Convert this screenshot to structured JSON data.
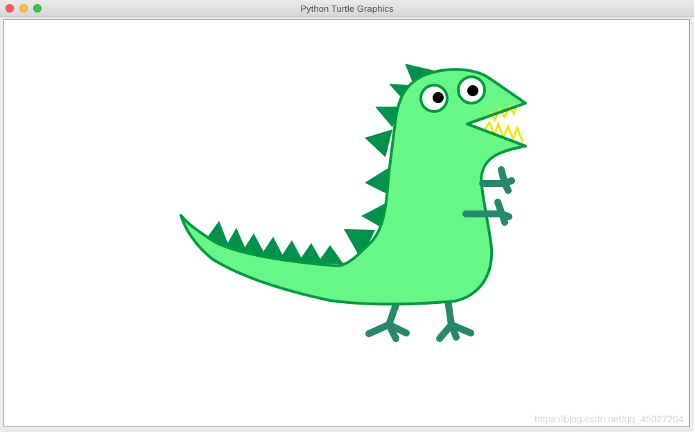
{
  "window": {
    "title": "Python Turtle Graphics",
    "controls": [
      "close-button",
      "minimize-button",
      "zoom-button"
    ]
  },
  "canvas": {
    "background": "#ffffff",
    "drawing": "dinosaur",
    "colors": {
      "body_fill": "#68f787",
      "outline": "#009a40",
      "spikes": "#00914c",
      "limbs": "#27896b",
      "teeth": "#f2e600",
      "eye_white": "#ffffff",
      "pupil": "#000000"
    }
  },
  "watermark": "https://blog.csdn.net/qq_45027204"
}
